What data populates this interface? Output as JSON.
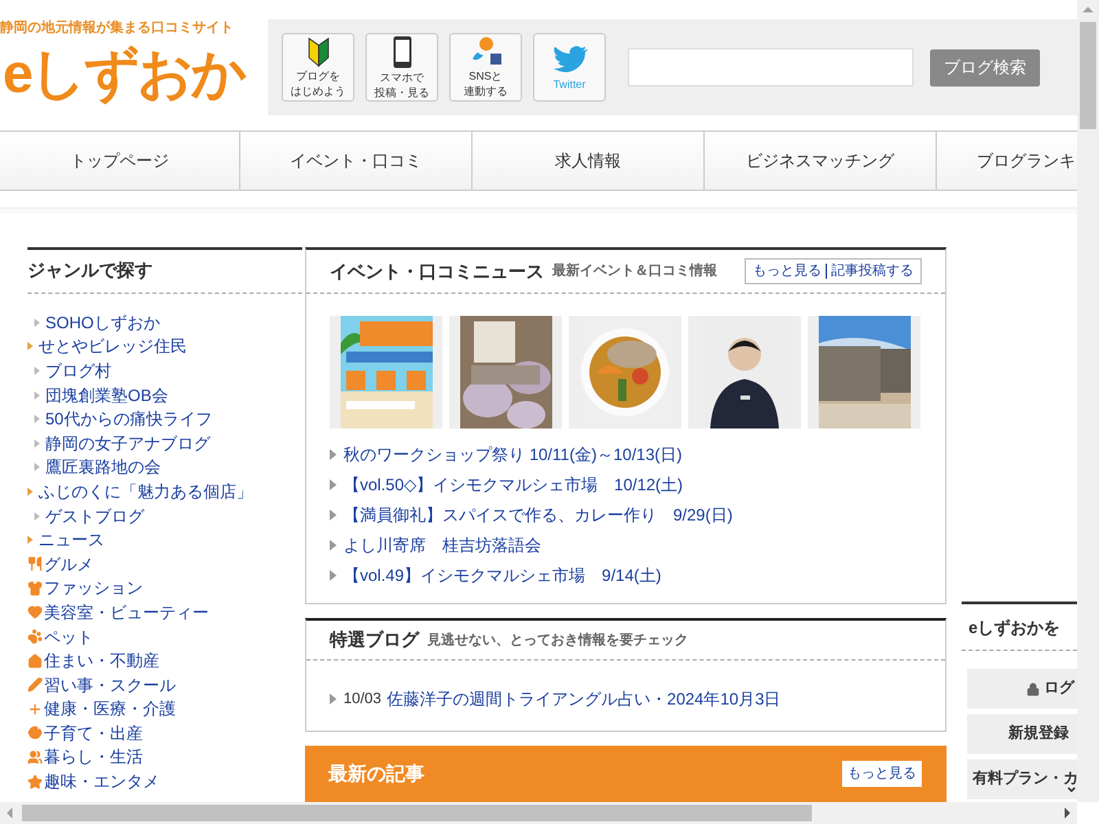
{
  "site": {
    "tagline": "静岡の地元情報が集まる口コミサイト",
    "logo_text": "eしずおか"
  },
  "header_buttons": [
    {
      "kind": "beginner",
      "lines": [
        "ブログを",
        "はじめよう"
      ]
    },
    {
      "kind": "phone",
      "lines": [
        "スマホで",
        "投稿・見る"
      ]
    },
    {
      "kind": "sns",
      "lines": [
        "SNSと",
        "連動する"
      ]
    },
    {
      "kind": "twitter",
      "lines": [
        "Twitter"
      ]
    }
  ],
  "search": {
    "button": "ブログ検索"
  },
  "nav": [
    {
      "label": "トップページ"
    },
    {
      "label": "イベント・口コミ"
    },
    {
      "label": "求人情報"
    },
    {
      "label": "ビジネスマッチング"
    },
    {
      "label": "ブログランキ"
    }
  ],
  "genre": {
    "title": "ジャンルで探す",
    "items": [
      {
        "kind": "sub",
        "label": "SOHOしずおか"
      },
      {
        "kind": "group",
        "label": "せとやビレッジ住民"
      },
      {
        "kind": "sub",
        "label": "ブログ村"
      },
      {
        "kind": "sub",
        "label": "団塊創業塾OB会"
      },
      {
        "kind": "sub",
        "label": "50代からの痛快ライフ"
      },
      {
        "kind": "sub",
        "label": "静岡の女子アナブログ"
      },
      {
        "kind": "sub",
        "label": "鷹匠裏路地の会"
      },
      {
        "kind": "group",
        "label": "ふじのくに「魅力ある個店」"
      },
      {
        "kind": "sub",
        "label": "ゲストブログ"
      },
      {
        "kind": "group",
        "label": "ニュース"
      },
      {
        "kind": "icon",
        "label": "グルメ"
      },
      {
        "kind": "icon",
        "label": "ファッション"
      },
      {
        "kind": "icon",
        "label": "美容室・ビューティー"
      },
      {
        "kind": "icon",
        "label": "ペット"
      },
      {
        "kind": "icon",
        "label": "住まい・不動産"
      },
      {
        "kind": "icon",
        "label": "習い事・スクール"
      },
      {
        "kind": "icon",
        "label": "健康・医療・介護"
      },
      {
        "kind": "icon",
        "label": "子育て・出産"
      },
      {
        "kind": "icon",
        "label": "暮らし・生活"
      },
      {
        "kind": "icon",
        "label": "趣味・エンタメ"
      }
    ]
  },
  "events": {
    "title": "イベント・口コミニュース",
    "subtitle": "最新イベント＆口コミ情報",
    "links": [
      "もっと見る",
      "記事投稿する"
    ],
    "pictures": [
      {
        "kind": "picture"
      },
      {
        "kind": "picture"
      },
      {
        "kind": "picture"
      },
      {
        "kind": "picture"
      },
      {
        "kind": "picture"
      }
    ],
    "items": [
      "秋のワークショップ祭り 10/11(金)～10/13(日)",
      "【vol.50◇】イシモクマルシェ市場　10/12(土)",
      "【満員御礼】スパイスで作る、カレー作り　9/29(日)",
      "よし川寄席　桂吉坊落語会",
      "【vol.49】イシモクマルシェ市場　9/14(土)"
    ]
  },
  "featured": {
    "title": "特選ブログ",
    "subtitle": "見逃せない、とっておき情報を要チェック",
    "items": [
      {
        "date": "10/03",
        "title": "佐藤洋子の週間トライアングル占い・2024年10月3日"
      }
    ]
  },
  "latest": {
    "title": "最新の記事",
    "more": "もっと見る"
  },
  "sidebar": {
    "title": "eしずおかを",
    "buttons": [
      {
        "kind": "login",
        "label": "ログ"
      },
      {
        "kind": "plain",
        "label": "新規登録"
      },
      {
        "kind": "menu",
        "label": "有料プラン・カ"
      }
    ]
  }
}
